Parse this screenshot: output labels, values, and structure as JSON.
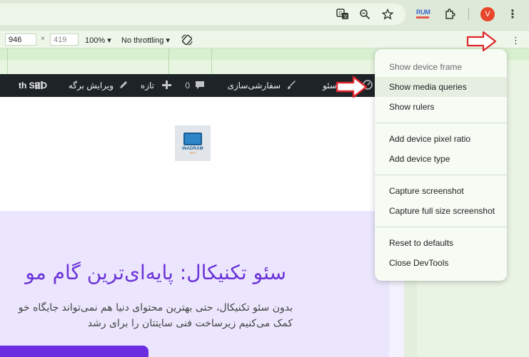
{
  "browser": {
    "extension_label": "RUM",
    "avatar_letter": "V",
    "kebab_glyph": "⋮"
  },
  "device_toolbar": {
    "width_value": "946",
    "times": "×",
    "height_value": "419",
    "zoom_label": "100% ▾",
    "throttle_label": "No throttling ▾",
    "kebab_glyph": "⋮"
  },
  "admin_bar": {
    "rankmath_label": "th SEO",
    "edit_page_label": "ویرایش برگه",
    "new_label": "تازه",
    "comments_count": "0",
    "customize_label": "سفارشی‌سازی",
    "site_label": "ام سئو"
  },
  "logo": {
    "text": "INADRAM",
    "sub": "SEO"
  },
  "hero": {
    "title": "سئو تکنیکال: پایه‌ای‌ترین گام مو",
    "line1": "بدون سئو تکنیکال، حتی بهترین محتوای دنیا هم نمی‌تواند جایگاه خو",
    "line2": "کمک می‌کنیم زیرساخت فنی سایتتان را برای رشد"
  },
  "menu": {
    "items": [
      {
        "label": "Show device frame",
        "disabled": true
      },
      {
        "label": "Show media queries",
        "highlighted": true
      },
      {
        "label": "Show rulers"
      },
      {
        "label": "Add device pixel ratio"
      },
      {
        "label": "Add device type"
      },
      {
        "label": "Capture screenshot"
      },
      {
        "label": "Capture full size screenshot"
      },
      {
        "label": "Reset to defaults"
      },
      {
        "label": "Close DevTools"
      }
    ]
  },
  "colors": {
    "accent_purple": "#6b33d8",
    "arrow_red": "#e0262b",
    "admin_bar": "#1d2327"
  },
  "icons": [
    "translate-icon",
    "zoom-icon",
    "star-icon",
    "puzzle-icon",
    "rotate-icon",
    "pencil-icon",
    "plus-icon",
    "comment-icon",
    "brush-icon",
    "gauge-icon",
    "chart-icon"
  ]
}
